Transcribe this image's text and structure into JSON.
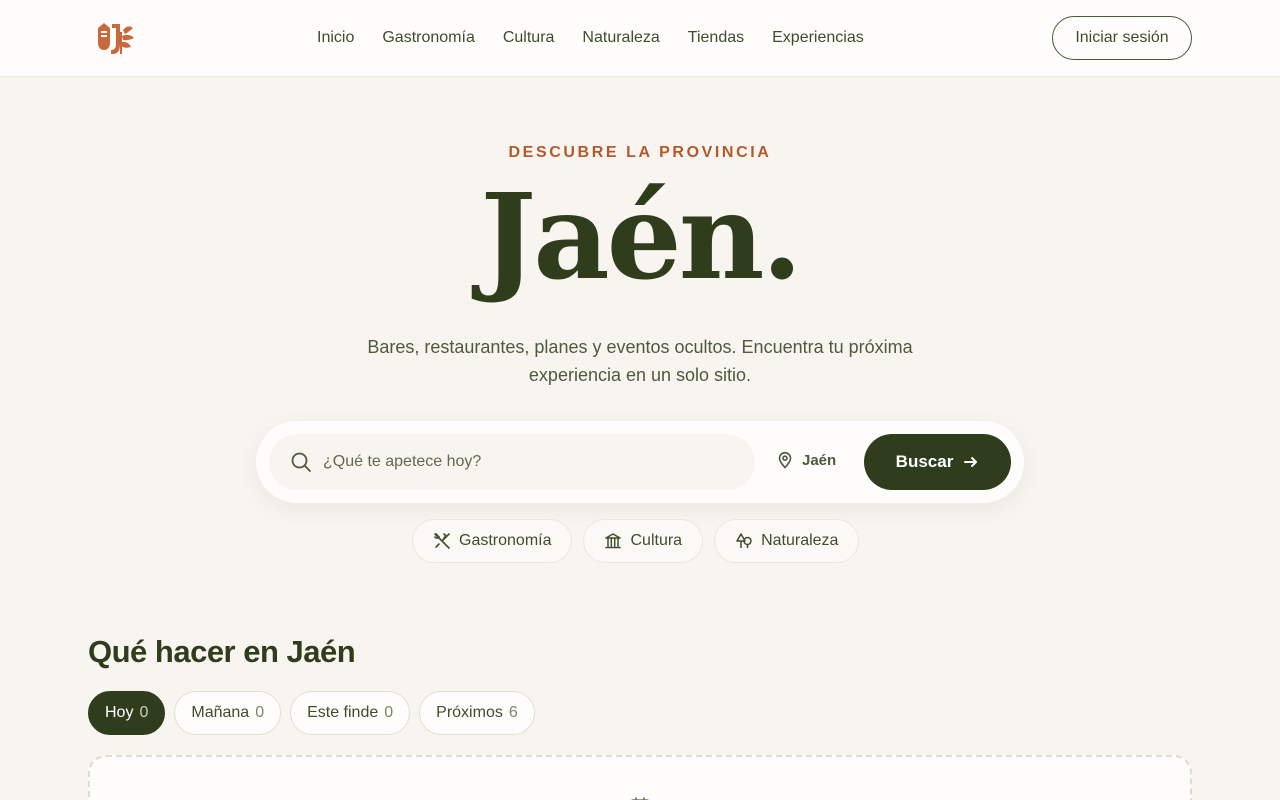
{
  "header": {
    "nav": [
      "Inicio",
      "Gastronomía",
      "Cultura",
      "Naturaleza",
      "Tiendas",
      "Experiencias"
    ],
    "login_label": "Iniciar sesión",
    "logo_icon": "jaen-logo-icon"
  },
  "hero": {
    "eyebrow": "DESCUBRE LA PROVINCIA",
    "title": "Jaén.",
    "subtitle": "Bares, restaurantes, planes y eventos ocultos. Encuentra tu próxima experiencia en un solo sitio."
  },
  "search": {
    "placeholder": "¿Qué te apetece hoy?",
    "location": "Jaén",
    "button_label": "Buscar"
  },
  "categories": [
    {
      "label": "Gastronomía",
      "icon": "utensils-icon"
    },
    {
      "label": "Cultura",
      "icon": "museum-icon"
    },
    {
      "label": "Naturaleza",
      "icon": "trees-icon"
    }
  ],
  "section": {
    "title": "Qué hacer en Jaén",
    "tabs": [
      {
        "label": "Hoy",
        "count": "0",
        "active": true
      },
      {
        "label": "Mañana",
        "count": "0",
        "active": false
      },
      {
        "label": "Este finde",
        "count": "0",
        "active": false
      },
      {
        "label": "Próximos",
        "count": "6",
        "active": false
      }
    ]
  },
  "colors": {
    "brand_dark": "#2f3d1c",
    "accent": "#b35a2c",
    "background": "#f8f5f0"
  }
}
